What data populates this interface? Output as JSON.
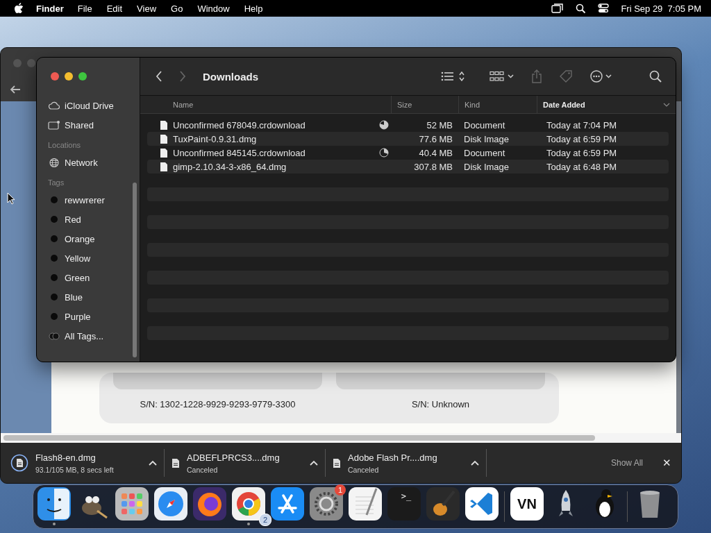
{
  "menu_bar": {
    "app": "Finder",
    "items": [
      "File",
      "Edit",
      "View",
      "Go",
      "Window",
      "Help"
    ],
    "clock": "Fri Sep 29  7:05 PM"
  },
  "browser": {
    "serials": [
      "S/N: 1302-1228-9929-9293-9779-3300",
      "S/N: Unknown"
    ],
    "downloads": [
      {
        "name": "Flash8-en.dmg",
        "status": "93.1/105 MB, 8 secs left",
        "kind": "progress"
      },
      {
        "name": "ADBEFLPRCS3....dmg",
        "status": "Canceled",
        "kind": "file"
      },
      {
        "name": "Adobe Flash Pr....dmg",
        "status": "Canceled",
        "kind": "file"
      }
    ],
    "show_all": "Show All",
    "close": "✕"
  },
  "finder": {
    "title": "Downloads",
    "sidebar": [
      {
        "kind": "cloud",
        "label": "iCloud Drive"
      },
      {
        "kind": "shared",
        "label": "Shared"
      },
      {
        "kind": "heading",
        "label": "Locations"
      },
      {
        "kind": "network",
        "label": "Network"
      },
      {
        "kind": "heading",
        "label": "Tags"
      },
      {
        "kind": "tag",
        "label": "rewwrerer"
      },
      {
        "kind": "tag",
        "label": "Red"
      },
      {
        "kind": "tag",
        "label": "Orange"
      },
      {
        "kind": "tag",
        "label": "Yellow"
      },
      {
        "kind": "tag",
        "label": "Green"
      },
      {
        "kind": "tag",
        "label": "Blue"
      },
      {
        "kind": "tag",
        "label": "Purple"
      },
      {
        "kind": "alltags",
        "label": "All Tags..."
      }
    ],
    "columns": [
      {
        "label": "Name",
        "sorted": false
      },
      {
        "label": "Size",
        "sorted": false
      },
      {
        "label": "Kind",
        "sorted": false
      },
      {
        "label": "Date Added",
        "sorted": true
      }
    ],
    "files": [
      {
        "name": "Unconfirmed 678049.crdownload",
        "level": 0.8,
        "size": "52 MB",
        "kind": "Document",
        "date": "Today at 7:04 PM"
      },
      {
        "name": "TuxPaint-0.9.31.dmg",
        "size": "77.6 MB",
        "kind": "Disk Image",
        "date": "Today at 6:59 PM"
      },
      {
        "name": "Unconfirmed 845145.crdownload",
        "level": 0.3,
        "size": "40.4 MB",
        "kind": "Document",
        "date": "Today at 6:59 PM"
      },
      {
        "name": "gimp-2.10.34-3-x86_64.dmg",
        "size": "307.8 MB",
        "kind": "Disk Image",
        "date": "Today at 6:48 PM"
      }
    ]
  },
  "dock": [
    {
      "kind": "finder",
      "running": true
    },
    {
      "kind": "gimp",
      "running": false
    },
    {
      "kind": "launchpad",
      "running": false
    },
    {
      "kind": "safari",
      "running": false
    },
    {
      "kind": "firefox",
      "running": false
    },
    {
      "kind": "chrome",
      "running": true,
      "badge": "2"
    },
    {
      "kind": "appstore",
      "running": false
    },
    {
      "kind": "settings",
      "running": false,
      "badge": "1"
    },
    {
      "kind": "textedit",
      "running": false
    },
    {
      "kind": "terminal",
      "running": false,
      "label": ">_"
    },
    {
      "kind": "garageband",
      "running": false
    },
    {
      "kind": "vscode",
      "running": false
    },
    {
      "kind": "sep"
    },
    {
      "kind": "vn",
      "running": false,
      "label": "VN"
    },
    {
      "kind": "rocket",
      "running": false
    },
    {
      "kind": "tux",
      "running": false
    },
    {
      "kind": "sep"
    },
    {
      "kind": "trash",
      "running": false
    }
  ]
}
